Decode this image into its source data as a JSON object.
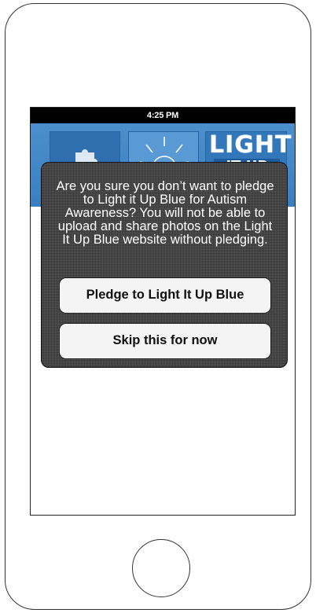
{
  "status_bar": {
    "time": "4:25 PM"
  },
  "banner": {
    "logo_line1": "LIGHT",
    "logo_line2": "IT UP"
  },
  "dialog": {
    "message": "Are you sure you don’t want to pledge to Light it Up Blue for Autism Awareness? You will not be able to upload and share photos on the Light It Up Blue website without pledging.",
    "pledge_label": "Pledge to Light It Up Blue",
    "skip_label": "Skip this for now"
  },
  "colors": {
    "banner_blue": "#3a7fc0",
    "overlay_gray": "#5a5a5a",
    "button_fill": "#f4f4f4"
  }
}
